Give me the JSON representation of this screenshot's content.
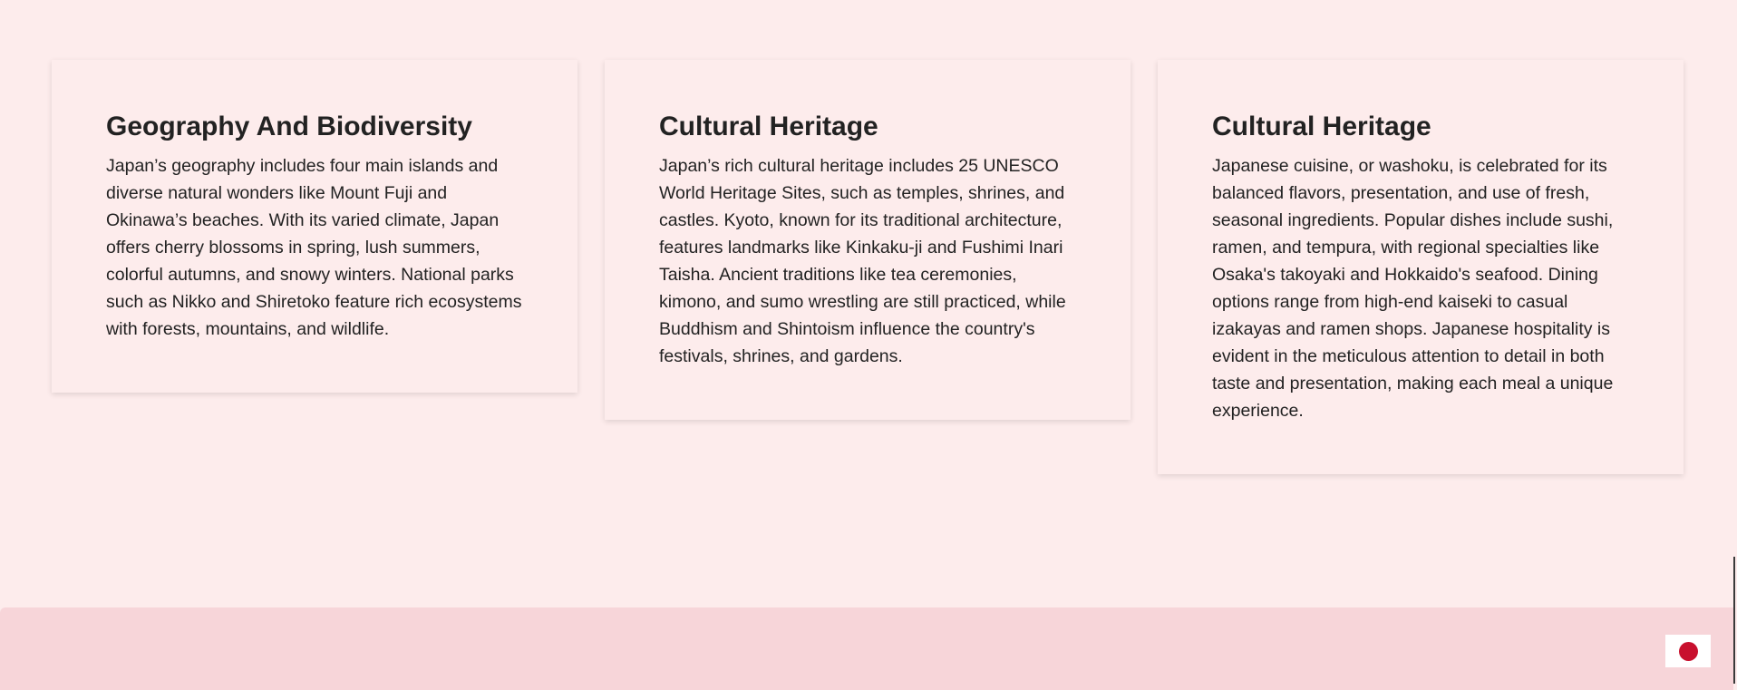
{
  "cards": [
    {
      "title": "Geography And Biodiversity",
      "body": "Japan’s geography includes four main islands and diverse natural wonders like Mount Fuji and Okinawa’s beaches. With its varied climate, Japan offers cherry blossoms in spring, lush summers, colorful autumns, and snowy winters. National parks such as Nikko and Shiretoko feature rich ecosystems with forests, mountains, and wildlife."
    },
    {
      "title": "Cultural Heritage",
      "body": "Japan’s rich cultural heritage includes 25 UNESCO World Heritage Sites, such as temples, shrines, and castles. Kyoto, known for its traditional architecture, features landmarks like Kinkaku-ji and Fushimi Inari Taisha. Ancient traditions like tea ceremonies, kimono, and sumo wrestling are still practiced, while Buddhism and Shintoism influence the country's festivals, shrines, and gardens."
    },
    {
      "title": "Cultural Heritage",
      "body": "Japanese cuisine, or washoku, is celebrated for its balanced flavors, presentation, and use of fresh, seasonal ingredients. Popular dishes include sushi, ramen, and tempura, with regional specialties like Osaka's takoyaki and Hokkaido's seafood. Dining options range from high-end kaiseki to casual izakayas and ramen shops. Japanese hospitality is evident in the meticulous attention to detail in both taste and presentation, making each meal a unique experience."
    }
  ],
  "footer": {
    "flag_icon": "japan-flag-icon",
    "flag_color": "#c8102e"
  },
  "colors": {
    "page_background": "#fdecec",
    "footer_background": "#f7d5d9",
    "text": "#222222"
  }
}
